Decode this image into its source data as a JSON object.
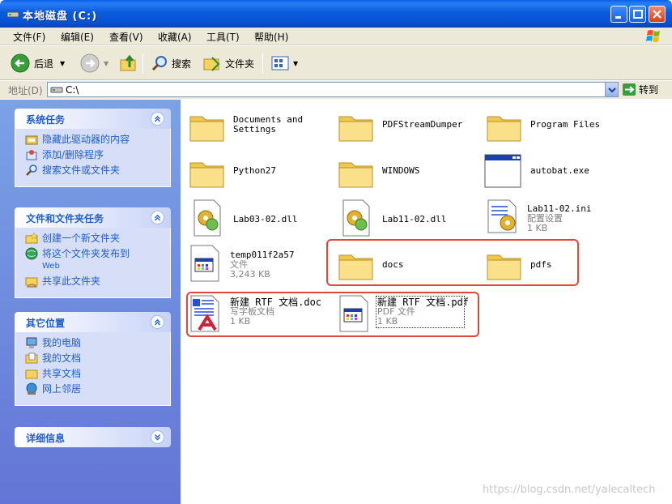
{
  "window": {
    "title": "本地磁盘 (C:)"
  },
  "menu": [
    "文件(F)",
    "编辑(E)",
    "查看(V)",
    "收藏(A)",
    "工具(T)",
    "帮助(H)"
  ],
  "toolbar": {
    "back": "后退",
    "search": "搜索",
    "folders": "文件夹"
  },
  "address": {
    "label": "地址(D)",
    "value": "C:\\",
    "go": "转到"
  },
  "left": {
    "system_tasks": {
      "title": "系统任务",
      "items": [
        "隐藏此驱动器的内容",
        "添加/删除程序",
        "搜索文件或文件夹"
      ]
    },
    "file_tasks": {
      "title": "文件和文件夹任务",
      "items": [
        "创建一个新文件夹",
        "将这个文件夹发布到",
        "Web",
        "共享此文件夹"
      ]
    },
    "other_places": {
      "title": "其它位置",
      "items": [
        "我的电脑",
        "我的文档",
        "共享文档",
        "网上邻居"
      ]
    },
    "details": {
      "title": "详细信息"
    }
  },
  "files": [
    {
      "name": "Documents and\nSettings",
      "type": "folder"
    },
    {
      "name": "PDFStreamDumper",
      "type": "folder"
    },
    {
      "name": "Program Files",
      "type": "folder"
    },
    {
      "name": "Python27",
      "type": "folder"
    },
    {
      "name": "WINDOWS",
      "type": "folder"
    },
    {
      "name": "autobat.exe",
      "type": "exe"
    },
    {
      "name": "Lab03-02.dll",
      "type": "dll"
    },
    {
      "name": "Lab11-02.dll",
      "type": "dll"
    },
    {
      "name": "Lab11-02.ini",
      "type": "ini",
      "kind": "配置设置",
      "size": "1 KB"
    },
    {
      "name": "temp011f2a57",
      "type": "file",
      "kind": "文件",
      "size": "3,243 KB"
    },
    {
      "name": "docs",
      "type": "folder"
    },
    {
      "name": "pdfs",
      "type": "folder"
    },
    {
      "name": "新建 RTF 文档.doc",
      "type": "doc",
      "kind": "写字板文档",
      "size": "1 KB"
    },
    {
      "name": "新建 RTF 文档.pdf",
      "type": "pdf",
      "kind": "PDF 文件",
      "size": "1 KB"
    }
  ],
  "watermark": "https://blog.csdn.net/yalecaltech",
  "colors": {
    "title_blue": "#0b5bdc",
    "panel_blue": "#6375d6",
    "link_blue": "#215dc6",
    "highlight_red": "#e0463a"
  }
}
